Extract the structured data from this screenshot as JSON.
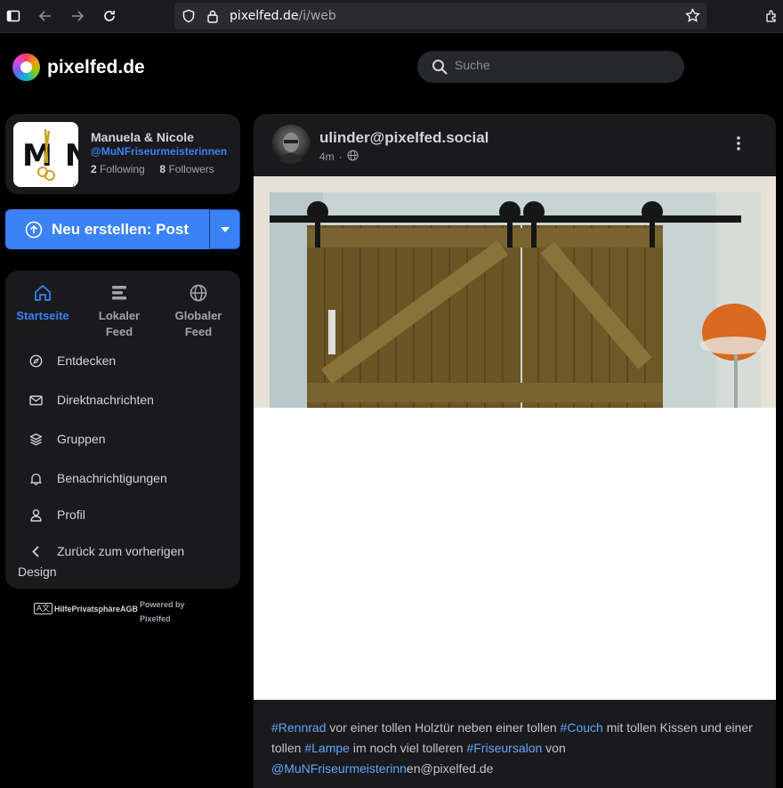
{
  "browser": {
    "url_host": "pixelfed.de",
    "url_path": "/i/web"
  },
  "header": {
    "brand": "pixelfed.de",
    "search_placeholder": "Suche"
  },
  "profile": {
    "name": "Manuela & Nicole",
    "handle": "@MuNFriseurmeisterinnen",
    "following_count": "2",
    "following_label": "Following",
    "followers_count": "8",
    "followers_label": "Followers",
    "avatar_letters": "MN"
  },
  "create": {
    "label": "Neu erstellen: Post"
  },
  "feeds": [
    {
      "label_1": "Startseite",
      "label_2": ""
    },
    {
      "label_1": "Lokaler",
      "label_2": "Feed"
    },
    {
      "label_1": "Globaler",
      "label_2": "Feed"
    }
  ],
  "menu": {
    "discover": "Entdecken",
    "messages": "Direktnachrichten",
    "groups": "Gruppen",
    "notifications": "Benachrichtigungen",
    "profile": "Profil",
    "back_line1": "Zurück zum vorherigen",
    "back_line2": "Design"
  },
  "footer": {
    "lang": "A文",
    "links": "HilfePrivatsphäreAGB",
    "powered_1": "Powered by",
    "powered_2": "Pixelfed"
  },
  "post": {
    "username": "ulinder@pixelfed.social",
    "time": "4m",
    "separator": "·",
    "caption": [
      {
        "type": "tag",
        "text": "#Rennrad"
      },
      {
        "type": "text",
        "text": " vor einer tollen Holztür neben einer tollen "
      },
      {
        "type": "tag",
        "text": "#Couch"
      },
      {
        "type": "text",
        "text": " mit tollen Kissen und einer tollen "
      },
      {
        "type": "tag",
        "text": "#Lampe"
      },
      {
        "type": "text",
        "text": " im noch viel tolleren "
      },
      {
        "type": "tag",
        "text": "#Friseursalon"
      },
      {
        "type": "text",
        "text": " von "
      },
      {
        "type": "tag",
        "text": "@MuNFriseurmeisterinn"
      },
      {
        "type": "text",
        "text": "en@pixelfed.de"
      }
    ]
  },
  "colors": {
    "accent": "#3b82f6",
    "card": "#1a1a1d",
    "page": "#000000"
  }
}
